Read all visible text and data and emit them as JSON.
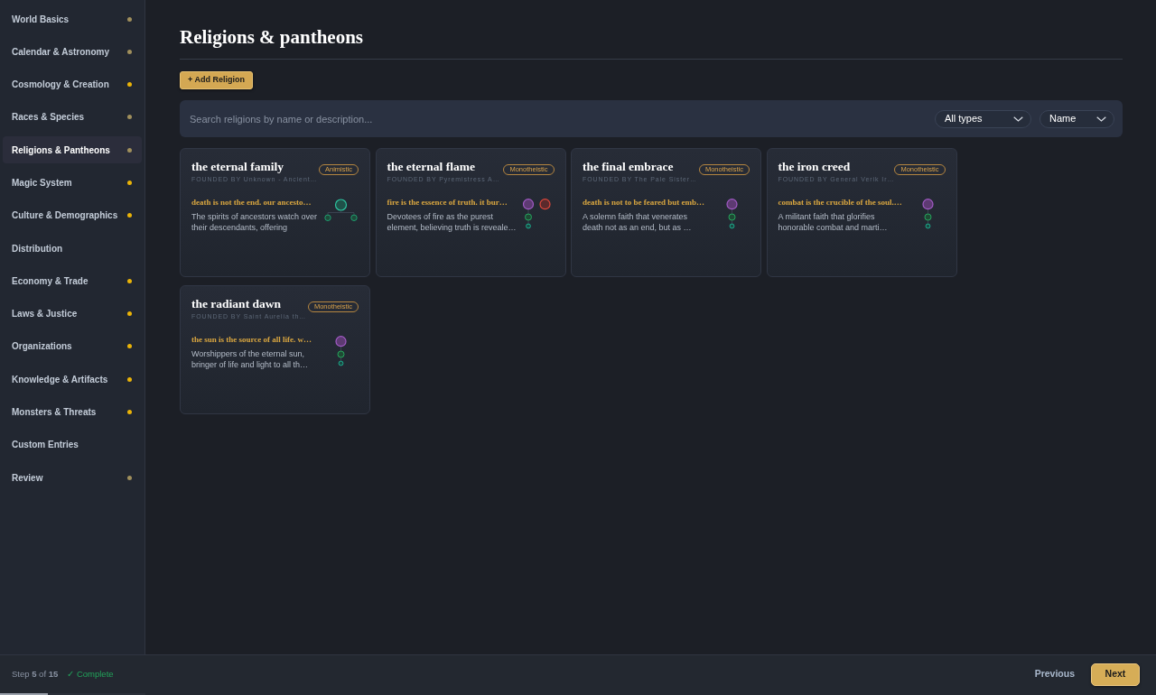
{
  "sidebar": {
    "items": [
      {
        "label": "World Basics",
        "selected": false,
        "color": "#a08f5c"
      },
      {
        "label": "Calendar & Astronomy",
        "selected": false,
        "color": "#a08f5c"
      },
      {
        "label": "Cosmology & Creation",
        "selected": false,
        "color": "#eab308"
      },
      {
        "label": "Races & Species",
        "selected": false,
        "color": "#a08f5c"
      },
      {
        "label": "Religions & Pantheons",
        "selected": true,
        "color": "#a08f5c"
      },
      {
        "label": "Magic System",
        "selected": false,
        "color": "#eab308"
      },
      {
        "label": "Culture & Demographics",
        "selected": false,
        "color": "#eab308"
      },
      {
        "label": "Distribution",
        "selected": false
      },
      {
        "label": "Economy & Trade",
        "selected": false,
        "color": "#eab308"
      },
      {
        "label": "Laws & Justice",
        "selected": false,
        "color": "#eab308"
      },
      {
        "label": "Organizations",
        "selected": false,
        "color": "#eab308"
      },
      {
        "label": "Knowledge & Artifacts",
        "selected": false,
        "color": "#eab308"
      },
      {
        "label": "Monsters & Threats",
        "selected": false,
        "color": "#eab308"
      },
      {
        "label": "Custom Entries",
        "selected": false
      },
      {
        "label": "Review",
        "selected": false,
        "color": "#a08f5c"
      }
    ]
  },
  "page": {
    "title": "Religions & pantheons",
    "add_button": "+ Add Religion"
  },
  "filters": {
    "search": {
      "placeholder": "Search religions by name or description..."
    },
    "selects": [
      {
        "value": "All types"
      },
      {
        "value": "Name"
      }
    ]
  },
  "religions": [
    {
      "name": "the eternal family",
      "type": "Animistic",
      "founded": "FOUNDED BY Unknown - Ancient…",
      "tenet": "death is not the end. our ancesto…",
      "description": "The spirits of ancestors watch over\ntheir descendants, offering",
      "diagram": {
        "kind": "tree"
      }
    },
    {
      "name": "the eternal flame",
      "type": "Monotheistic",
      "founded": "FOUNDED BY Pyremistress A…",
      "tenet": "fire is the essence of truth. it bur…",
      "description": "Devotees of fire as the purest\nelement, believing truth is reveale…",
      "diagram": {
        "kind": "pair-chain"
      }
    },
    {
      "name": "the final embrace",
      "type": "Monotheistic",
      "founded": "FOUNDED BY The Pale Sister…",
      "tenet": "death is not to be feared but emb…",
      "description": "A solemn faith that venerates\ndeath not as an end, but as …",
      "diagram": {
        "kind": "chain"
      }
    },
    {
      "name": "the iron creed",
      "type": "Monotheistic",
      "founded": "FOUNDED BY General Verik Ir…",
      "tenet": "combat is the crucible of the soul.…",
      "description": "A militant faith that glorifies\nhonorable combat and marti…",
      "diagram": {
        "kind": "chain"
      }
    },
    {
      "name": "the radiant dawn",
      "type": "Monotheistic",
      "founded": "FOUNDED BY Saint Aurelia th…",
      "tenet": "the sun is the source of all life. w…",
      "description": "Worshippers of the eternal sun,\nbringer of life and light to all th…",
      "diagram": {
        "kind": "chain"
      }
    }
  ],
  "footer": {
    "step": "Step **5** of **15**",
    "status": "✓ Complete",
    "progress": {
      "level": 0.33
    },
    "buttons": [
      {
        "label": "Previous",
        "kind": "ghost"
      },
      {
        "label": "Next",
        "kind": "primary"
      }
    ]
  }
}
